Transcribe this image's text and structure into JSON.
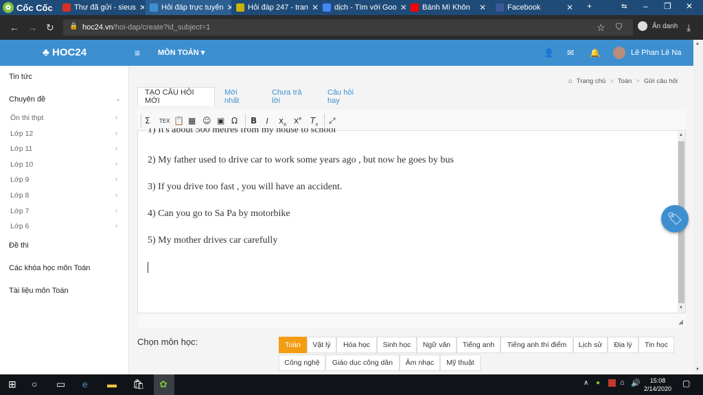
{
  "browser": {
    "brand": "Cốc Cốc",
    "tabs": [
      {
        "label": "Thư đã gửi - sieus",
        "icon": "gmail-icon",
        "color": "#d93025"
      },
      {
        "label": "Hỏi đáp trực tuyến",
        "icon": "hoc24-icon",
        "color": "#3e8fd0"
      },
      {
        "label": "Hỏi đáp 247 - tran",
        "icon": "h-icon",
        "color": "#c9b400"
      },
      {
        "label": "dịch - Tìm với Goo",
        "icon": "google-icon",
        "color": "#4285f4"
      },
      {
        "label": "Bánh Mì Khôn",
        "icon": "youtube-icon",
        "color": "#ff0000"
      },
      {
        "label": "Facebook",
        "icon": "facebook-icon",
        "color": "#3b5998"
      }
    ],
    "url_domain": "hoc24.vn",
    "url_path": "/hoi-dap/create?id_subject=1",
    "incognito_label": "Ẩn danh"
  },
  "site": {
    "logo": "HOC24",
    "subject_menu": "MÔN TOÁN",
    "username": "Lê Phan Lê Na"
  },
  "sidebar": {
    "news": "Tin tức",
    "topics": "Chuyên đề",
    "grades": [
      "Ôn thi thpt",
      "Lớp 12",
      "Lớp 11",
      "Lớp 10",
      "Lớp 9",
      "Lớp 8",
      "Lớp 7",
      "Lớp 6"
    ],
    "exams": "Đề thi",
    "courses": "Các khóa học môn Toán",
    "materials": "Tài liệu môn Toán"
  },
  "breadcrumb": {
    "home": "Trang chủ",
    "subject": "Toán",
    "current": "Gửi câu hỏi"
  },
  "question_tabs": [
    "TẠO CÂU HỎI MỚI",
    "Mới nhất",
    "Chưa trả lời",
    "Câu hỏi hay"
  ],
  "editor": {
    "lines": [
      "1) It's about 500 metres from my house to school",
      "2) My father used to drive car to work some years ago , but now he goes by bus",
      "3) If you drive too fast , you will have an accident.",
      "4) Can you go to Sa Pa by motorbike",
      "5) My mother drives car carefully"
    ]
  },
  "subject_chooser": {
    "label": "Chọn môn học:",
    "row1": [
      "Toán",
      "Vật lý",
      "Hóa học",
      "Sinh học",
      "Ngữ văn",
      "Tiếng anh",
      "Tiếng anh thí điểm",
      "Lịch sử",
      "Địa lý",
      "Tin học"
    ],
    "row2": [
      "Công nghệ",
      "Giáo dục công dân",
      "Âm nhạc",
      "Mỹ thuật"
    ],
    "selected": "Toán"
  },
  "taskbar": {
    "time": "15:08",
    "date": "2/14/2020"
  }
}
